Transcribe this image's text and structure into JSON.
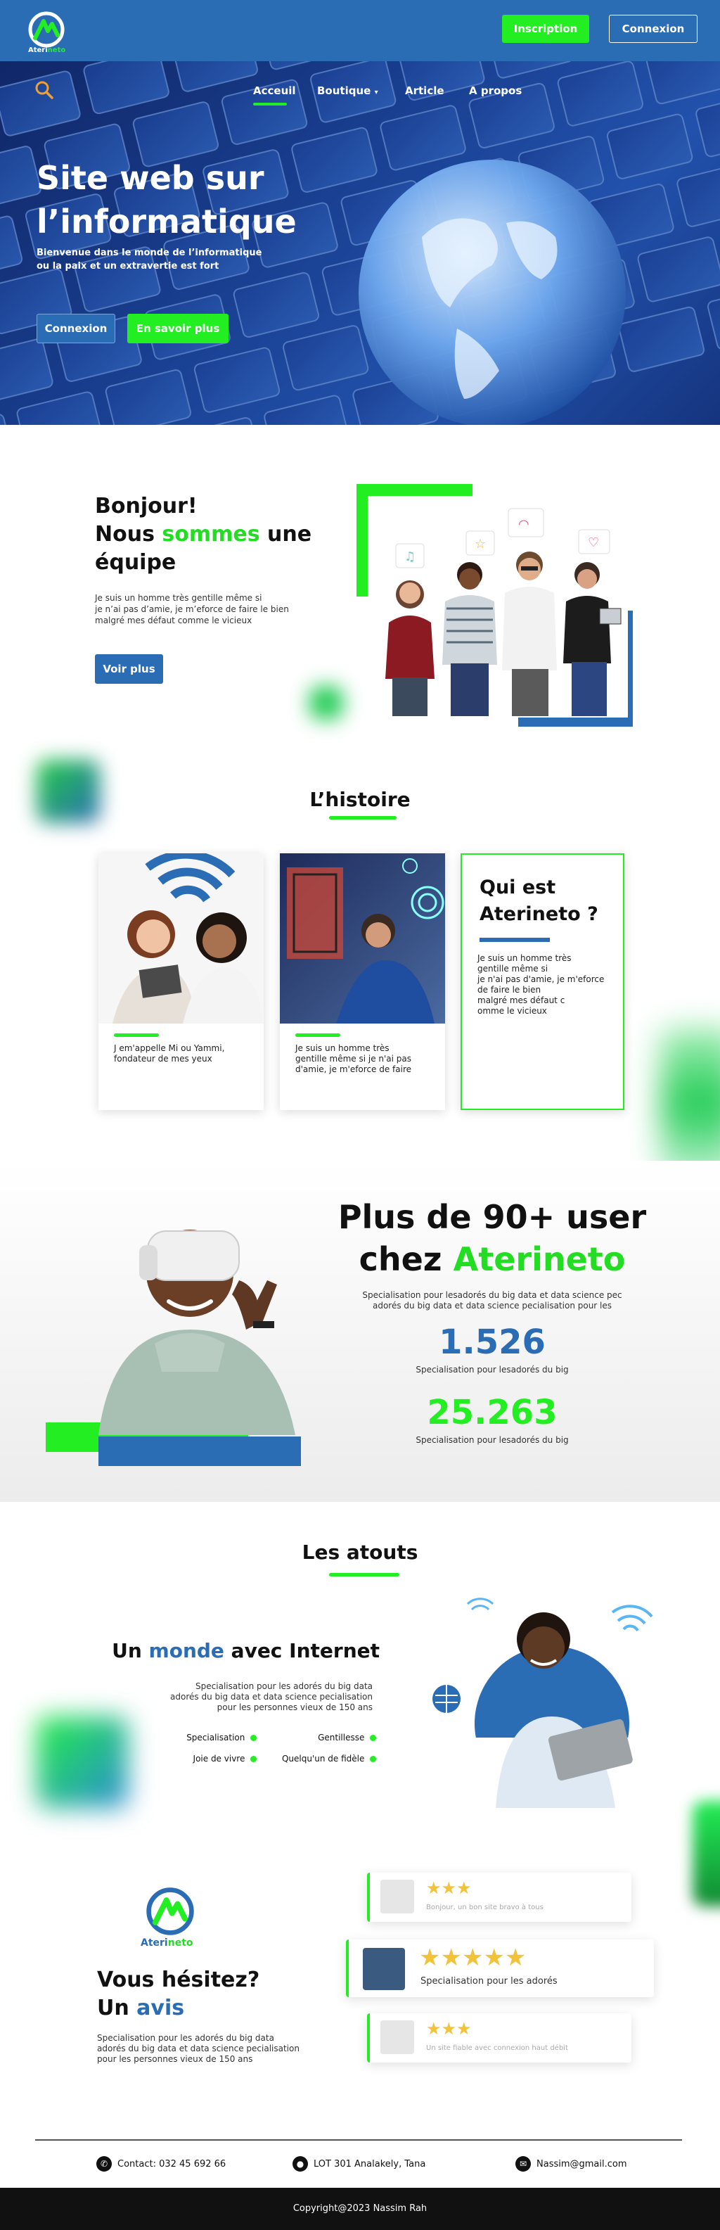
{
  "header": {
    "logo_text_a": "Ateri",
    "logo_text_b": "neto",
    "inscription_label": "Inscription",
    "connexion_label": "Connexion"
  },
  "nav": {
    "items": [
      "Acceuil",
      "Boutique",
      "Article",
      "A propos"
    ],
    "active": "Acceuil"
  },
  "hero": {
    "title_line1": "Site web sur",
    "title_line2": "l’informatique",
    "subtitle_line1": "Bienvenue dans le monde de l’informatique",
    "subtitle_line2": "ou la paix et un extravertie est fort",
    "btn_connexion": "Connexion",
    "btn_savoir": "En savoir plus"
  },
  "team": {
    "line1": "Bonjour!",
    "line2_a": "Nous ",
    "line2_b": "sommes",
    "line2_c": " une",
    "line3": "équipe",
    "text_1": "Je suis un homme très gentille même si",
    "text_2": "je n’ai pas d’amie, je m’eforce de faire le bien",
    "text_3": "malgré mes défaut comme le vicieux",
    "btn": "Voir plus"
  },
  "histoire": {
    "title": "L’histoire",
    "card1_1": "J em'appelle Mi ou Yammi,",
    "card1_2": "fondateur de mes yeux",
    "card2_1": "Je suis un homme très",
    "card2_2": "gentille même si je n'ai pas",
    "card2_3": "d'amie, je m'eforce de faire",
    "card3_title_1": "Qui est",
    "card3_title_2": "Aterineto ?",
    "card3_1": "Je suis un homme très",
    "card3_2": "gentille même si",
    "card3_3": "je n'ai pas d'amie, je m'eforce",
    "card3_4": "de faire le bien",
    "card3_5": "malgré mes défaut c",
    "card3_6": "omme le vicieux"
  },
  "stats": {
    "title_1": "Plus de 90+ user",
    "title_2a": "chez ",
    "title_2b": "Aterineto",
    "sub_1": "Specialisation pour lesadorés du big data et data science pec",
    "sub_2": "adorés du big data et data science pecialisation pour les",
    "num1": "1.526",
    "num1_label": "Specialisation pour lesadorés du big",
    "num2": "25.263",
    "num2_label": "Specialisation pour lesadorés du big"
  },
  "atouts": {
    "title": "Les atouts",
    "heading_a": "Un ",
    "heading_b": "monde",
    "heading_c": " avec Internet",
    "text_1": "Specialisation pour les adorés du big data",
    "text_2": "adorés du big data et data science pecialisation",
    "text_3": "pour les personnes vieux de 150 ans",
    "features": [
      "Specialisation",
      "Gentillesse",
      "Joie de vivre",
      "Quelqu'un de fidèle"
    ]
  },
  "avis": {
    "logo_a": "Ateri",
    "logo_b": "neto",
    "heading_1": "Vous hésitez?",
    "heading_2a": "Un ",
    "heading_2b": "avis",
    "text_1": "Specialisation pour les adorés du big data",
    "text_2": "adorés du big data et data science pecialisation",
    "text_3": "pour les personnes vieux de 150 ans",
    "reviews": [
      {
        "stars": 3,
        "text": "Bonjour, un bon site bravo à tous"
      },
      {
        "stars": 5,
        "text": "Specialisation pour les adorés"
      },
      {
        "stars": 3,
        "text": "Un site fiable avec connexion haut débit"
      }
    ]
  },
  "footer": {
    "contact": "Contact: 032 45 692 66",
    "address": "LOT 301 Analakely, Tana",
    "email": "Nassim@gmail.com",
    "copyright": "Copyright@2023 Nassim Rah"
  },
  "colors": {
    "brand_blue": "#2a6db5",
    "brand_green": "#22ee22"
  }
}
